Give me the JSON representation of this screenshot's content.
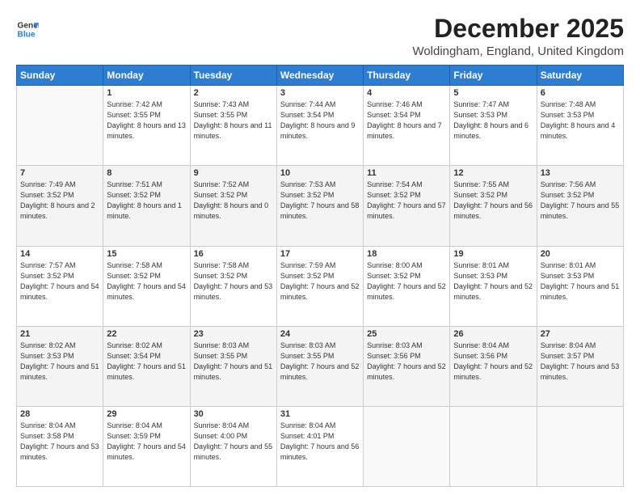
{
  "header": {
    "logo_line1": "General",
    "logo_line2": "Blue",
    "title": "December 2025",
    "subtitle": "Woldingham, England, United Kingdom"
  },
  "columns": [
    "Sunday",
    "Monday",
    "Tuesday",
    "Wednesday",
    "Thursday",
    "Friday",
    "Saturday"
  ],
  "weeks": [
    [
      {
        "day": "",
        "info": ""
      },
      {
        "day": "1",
        "info": "Sunrise: 7:42 AM\nSunset: 3:55 PM\nDaylight: 8 hours\nand 13 minutes."
      },
      {
        "day": "2",
        "info": "Sunrise: 7:43 AM\nSunset: 3:55 PM\nDaylight: 8 hours\nand 11 minutes."
      },
      {
        "day": "3",
        "info": "Sunrise: 7:44 AM\nSunset: 3:54 PM\nDaylight: 8 hours\nand 9 minutes."
      },
      {
        "day": "4",
        "info": "Sunrise: 7:46 AM\nSunset: 3:54 PM\nDaylight: 8 hours\nand 7 minutes."
      },
      {
        "day": "5",
        "info": "Sunrise: 7:47 AM\nSunset: 3:53 PM\nDaylight: 8 hours\nand 6 minutes."
      },
      {
        "day": "6",
        "info": "Sunrise: 7:48 AM\nSunset: 3:53 PM\nDaylight: 8 hours\nand 4 minutes."
      }
    ],
    [
      {
        "day": "7",
        "info": "Sunrise: 7:49 AM\nSunset: 3:52 PM\nDaylight: 8 hours\nand 2 minutes."
      },
      {
        "day": "8",
        "info": "Sunrise: 7:51 AM\nSunset: 3:52 PM\nDaylight: 8 hours\nand 1 minute."
      },
      {
        "day": "9",
        "info": "Sunrise: 7:52 AM\nSunset: 3:52 PM\nDaylight: 8 hours\nand 0 minutes."
      },
      {
        "day": "10",
        "info": "Sunrise: 7:53 AM\nSunset: 3:52 PM\nDaylight: 7 hours\nand 58 minutes."
      },
      {
        "day": "11",
        "info": "Sunrise: 7:54 AM\nSunset: 3:52 PM\nDaylight: 7 hours\nand 57 minutes."
      },
      {
        "day": "12",
        "info": "Sunrise: 7:55 AM\nSunset: 3:52 PM\nDaylight: 7 hours\nand 56 minutes."
      },
      {
        "day": "13",
        "info": "Sunrise: 7:56 AM\nSunset: 3:52 PM\nDaylight: 7 hours\nand 55 minutes."
      }
    ],
    [
      {
        "day": "14",
        "info": "Sunrise: 7:57 AM\nSunset: 3:52 PM\nDaylight: 7 hours\nand 54 minutes."
      },
      {
        "day": "15",
        "info": "Sunrise: 7:58 AM\nSunset: 3:52 PM\nDaylight: 7 hours\nand 54 minutes."
      },
      {
        "day": "16",
        "info": "Sunrise: 7:58 AM\nSunset: 3:52 PM\nDaylight: 7 hours\nand 53 minutes."
      },
      {
        "day": "17",
        "info": "Sunrise: 7:59 AM\nSunset: 3:52 PM\nDaylight: 7 hours\nand 52 minutes."
      },
      {
        "day": "18",
        "info": "Sunrise: 8:00 AM\nSunset: 3:52 PM\nDaylight: 7 hours\nand 52 minutes."
      },
      {
        "day": "19",
        "info": "Sunrise: 8:01 AM\nSunset: 3:53 PM\nDaylight: 7 hours\nand 52 minutes."
      },
      {
        "day": "20",
        "info": "Sunrise: 8:01 AM\nSunset: 3:53 PM\nDaylight: 7 hours\nand 51 minutes."
      }
    ],
    [
      {
        "day": "21",
        "info": "Sunrise: 8:02 AM\nSunset: 3:53 PM\nDaylight: 7 hours\nand 51 minutes."
      },
      {
        "day": "22",
        "info": "Sunrise: 8:02 AM\nSunset: 3:54 PM\nDaylight: 7 hours\nand 51 minutes."
      },
      {
        "day": "23",
        "info": "Sunrise: 8:03 AM\nSunset: 3:55 PM\nDaylight: 7 hours\nand 51 minutes."
      },
      {
        "day": "24",
        "info": "Sunrise: 8:03 AM\nSunset: 3:55 PM\nDaylight: 7 hours\nand 52 minutes."
      },
      {
        "day": "25",
        "info": "Sunrise: 8:03 AM\nSunset: 3:56 PM\nDaylight: 7 hours\nand 52 minutes."
      },
      {
        "day": "26",
        "info": "Sunrise: 8:04 AM\nSunset: 3:56 PM\nDaylight: 7 hours\nand 52 minutes."
      },
      {
        "day": "27",
        "info": "Sunrise: 8:04 AM\nSunset: 3:57 PM\nDaylight: 7 hours\nand 53 minutes."
      }
    ],
    [
      {
        "day": "28",
        "info": "Sunrise: 8:04 AM\nSunset: 3:58 PM\nDaylight: 7 hours\nand 53 minutes."
      },
      {
        "day": "29",
        "info": "Sunrise: 8:04 AM\nSunset: 3:59 PM\nDaylight: 7 hours\nand 54 minutes."
      },
      {
        "day": "30",
        "info": "Sunrise: 8:04 AM\nSunset: 4:00 PM\nDaylight: 7 hours\nand 55 minutes."
      },
      {
        "day": "31",
        "info": "Sunrise: 8:04 AM\nSunset: 4:01 PM\nDaylight: 7 hours\nand 56 minutes."
      },
      {
        "day": "",
        "info": ""
      },
      {
        "day": "",
        "info": ""
      },
      {
        "day": "",
        "info": ""
      }
    ]
  ]
}
